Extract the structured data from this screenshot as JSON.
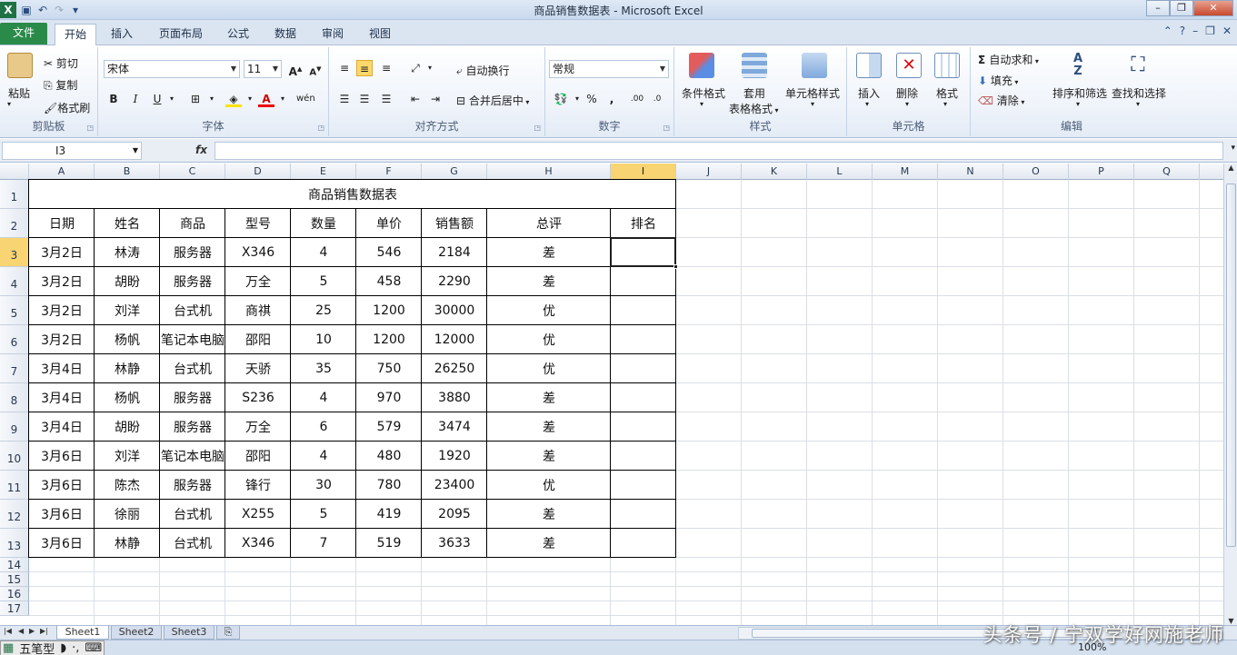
{
  "window": {
    "title": "商品销售数据表 - Microsoft Excel"
  },
  "tabs": [
    "文件",
    "开始",
    "插入",
    "页面布局",
    "公式",
    "数据",
    "审阅",
    "视图"
  ],
  "ribbon": {
    "clipboard": {
      "label": "剪贴板",
      "paste": "粘贴",
      "cut": "剪切",
      "copy": "复制",
      "format_painter": "格式刷"
    },
    "font": {
      "label": "字体",
      "name": "宋体",
      "size": "11"
    },
    "alignment": {
      "label": "对齐方式",
      "wrap": "自动换行",
      "merge": "合并后居中"
    },
    "number": {
      "label": "数字",
      "format": "常规"
    },
    "styles": {
      "label": "样式",
      "cond": "条件格式",
      "table1": "套用",
      "table2": "表格格式",
      "cellstyle": "单元格样式"
    },
    "cells": {
      "label": "单元格",
      "insert": "插入",
      "delete": "删除",
      "format": "格式"
    },
    "editing": {
      "label": "编辑",
      "autosum": "自动求和",
      "fill": "填充",
      "clear": "清除",
      "sort": "排序和筛选",
      "find": "查找和选择"
    }
  },
  "formula_bar": {
    "name_box": "I3",
    "fx": "fx",
    "value": ""
  },
  "sheet": {
    "columns": [
      "A",
      "B",
      "C",
      "D",
      "E",
      "F",
      "G",
      "H",
      "I",
      "J",
      "K",
      "L",
      "M",
      "N",
      "O",
      "P",
      "Q"
    ],
    "selected_column": "I",
    "selected_row": 3,
    "title": "商品销售数据表",
    "headers": [
      "日期",
      "姓名",
      "商品",
      "型号",
      "数量",
      "单价",
      "销售额",
      "总评",
      "排名"
    ],
    "rows": [
      [
        "3月2日",
        "林涛",
        "服务器",
        "X346",
        "4",
        "546",
        "2184",
        "差",
        ""
      ],
      [
        "3月2日",
        "胡盼",
        "服务器",
        "万全",
        "5",
        "458",
        "2290",
        "差",
        ""
      ],
      [
        "3月2日",
        "刘洋",
        "台式机",
        "商祺",
        "25",
        "1200",
        "30000",
        "优",
        ""
      ],
      [
        "3月2日",
        "杨帆",
        "笔记本电脑",
        "邵阳",
        "10",
        "1200",
        "12000",
        "优",
        ""
      ],
      [
        "3月4日",
        "林静",
        "台式机",
        "天骄",
        "35",
        "750",
        "26250",
        "优",
        ""
      ],
      [
        "3月4日",
        "杨帆",
        "服务器",
        "S236",
        "4",
        "970",
        "3880",
        "差",
        ""
      ],
      [
        "3月4日",
        "胡盼",
        "服务器",
        "万全",
        "6",
        "579",
        "3474",
        "差",
        ""
      ],
      [
        "3月6日",
        "刘洋",
        "笔记本电脑",
        "邵阳",
        "4",
        "480",
        "1920",
        "差",
        ""
      ],
      [
        "3月6日",
        "陈杰",
        "服务器",
        "锋行",
        "30",
        "780",
        "23400",
        "优",
        ""
      ],
      [
        "3月6日",
        "徐丽",
        "台式机",
        "X255",
        "5",
        "419",
        "2095",
        "差",
        ""
      ],
      [
        "3月6日",
        "林静",
        "台式机",
        "X346",
        "7",
        "519",
        "3633",
        "差",
        ""
      ]
    ],
    "row_numbers": [
      "1",
      "2",
      "3",
      "4",
      "5",
      "6",
      "7",
      "8",
      "9",
      "10",
      "11",
      "12",
      "13",
      "14",
      "15",
      "16",
      "17"
    ]
  },
  "sheet_tabs": [
    "Sheet1",
    "Sheet2",
    "Sheet3"
  ],
  "status": {
    "ime": "五笔型",
    "zoom": "100%"
  },
  "watermark": "头条号 / 宁双学好网施老师"
}
